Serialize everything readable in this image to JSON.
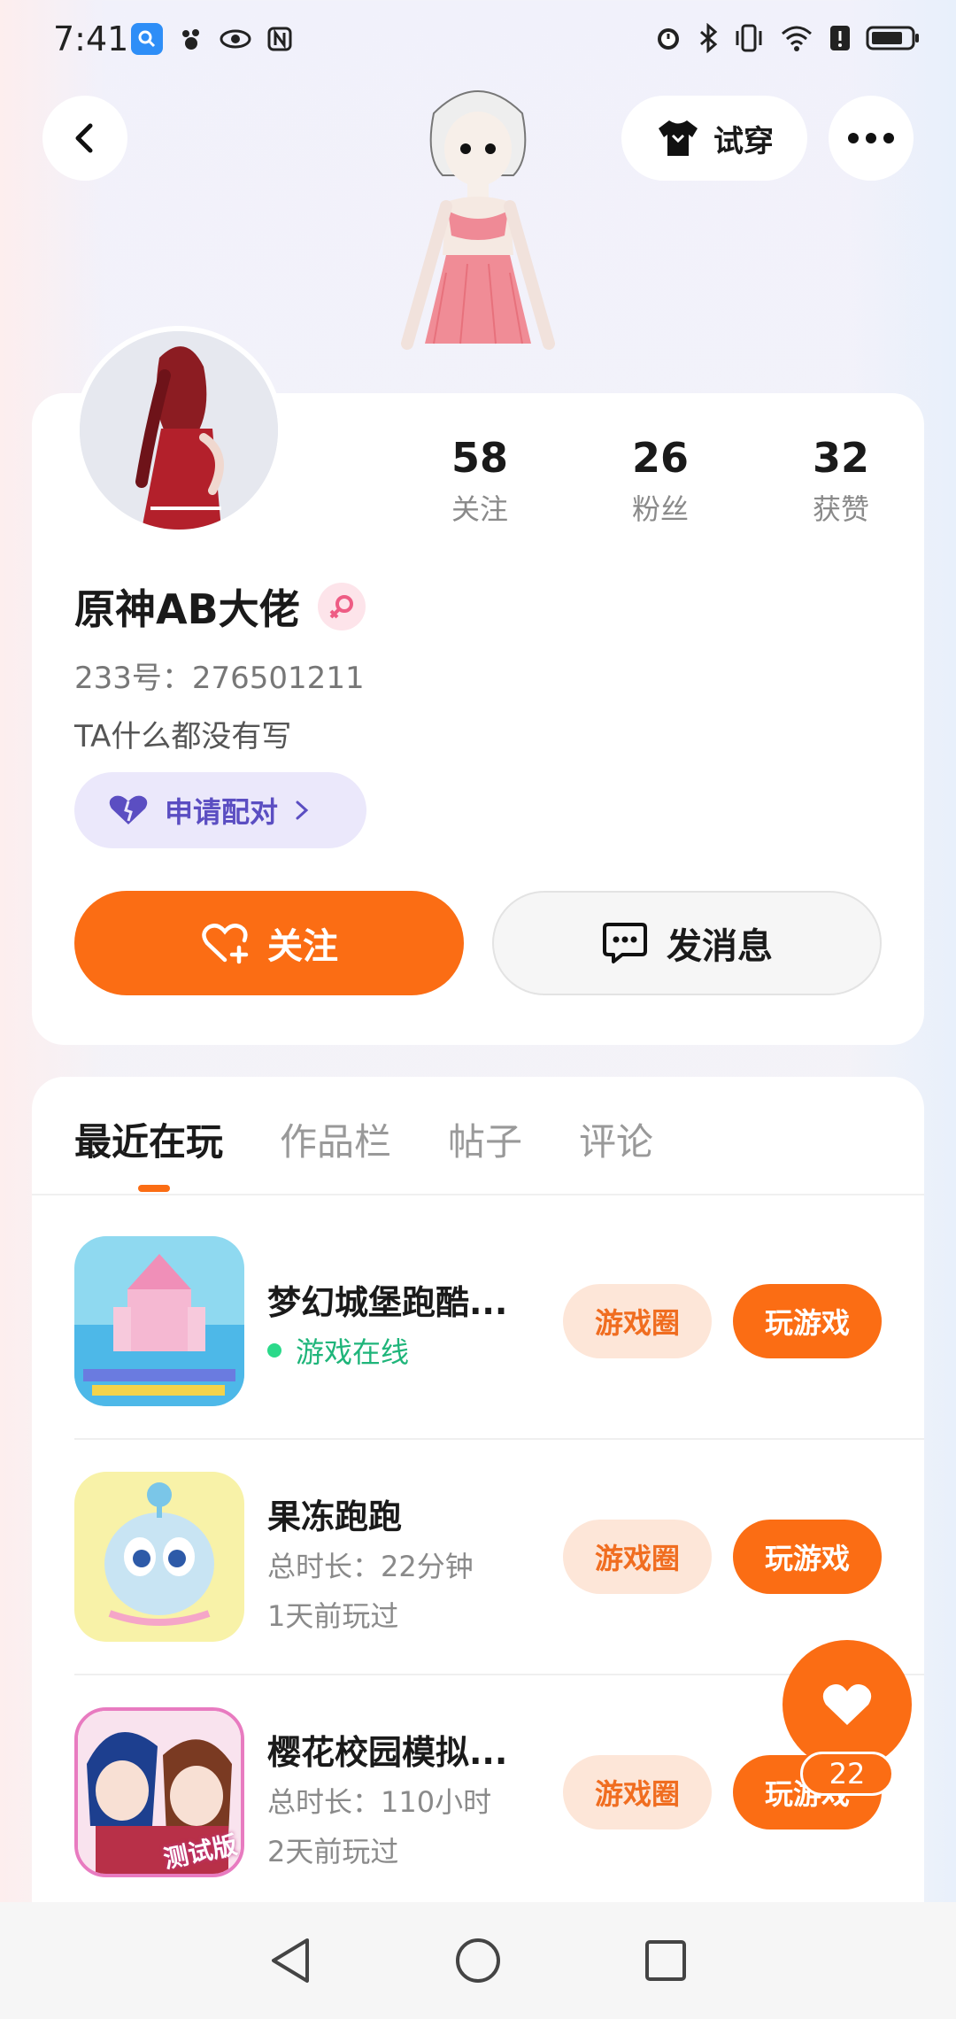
{
  "status_bar": {
    "time": "7:41"
  },
  "header": {
    "try_on_label": "试穿"
  },
  "profile": {
    "username": "原神AB大佬",
    "uid_text": "233号：276501211",
    "bio": "TA什么都没有写",
    "pair_label": "申请配对",
    "stats": [
      {
        "value": "58",
        "label": "关注"
      },
      {
        "value": "26",
        "label": "粉丝"
      },
      {
        "value": "32",
        "label": "获赞"
      }
    ],
    "follow_label": "关注",
    "message_label": "发消息"
  },
  "tabs": [
    {
      "label": "最近在玩",
      "active": true
    },
    {
      "label": "作品栏",
      "active": false
    },
    {
      "label": "帖子",
      "active": false
    },
    {
      "label": "评论",
      "active": false
    }
  ],
  "games": [
    {
      "title": "梦幻城堡跑酷...",
      "sub1": "游戏在线",
      "sub2": "",
      "online": true,
      "circle_label": "游戏圈",
      "play_label": "玩游戏"
    },
    {
      "title": "果冻跑跑",
      "sub1": "总时长：22分钟",
      "sub2": "1天前玩过",
      "online": false,
      "circle_label": "游戏圈",
      "play_label": "玩游戏"
    },
    {
      "title": "樱花校园模拟...",
      "sub1": "总时长：110小时",
      "sub2": "2天前玩过",
      "online": false,
      "circle_label": "游戏圈",
      "play_label": "玩游戏"
    }
  ],
  "game3_badge": "测试版",
  "like_fab": {
    "count": "22"
  },
  "colors": {
    "accent": "#fb6d14",
    "online": "#1fb57a",
    "pair": "#5b4ec2"
  }
}
